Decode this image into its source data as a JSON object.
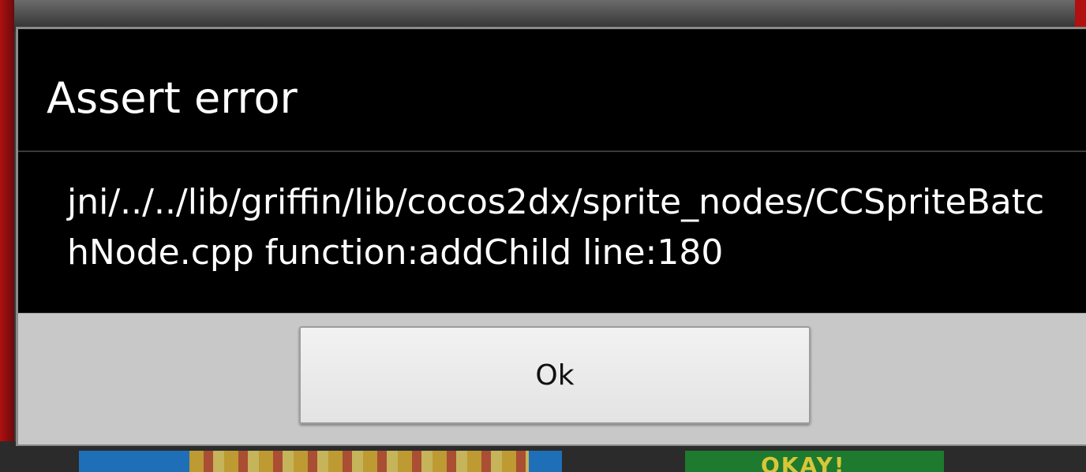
{
  "dialog": {
    "title": "Assert error",
    "message": "jni/../../lib/griffin/lib/cocos2dx/sprite_nodes/CCSpriteBatchNode.cpp function:addChild line:180",
    "ok_label": "Ok"
  },
  "background": {
    "okay_banner_text": "OKAY!"
  },
  "colors": {
    "dialog_bg": "#000000",
    "button_bar_bg": "#c8c8c8",
    "button_bg": "#eeeeee",
    "text_light": "#ffffff"
  }
}
